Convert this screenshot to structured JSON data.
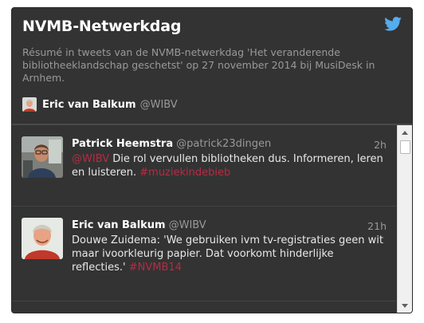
{
  "widget": {
    "title": "NVMB-Netwerkdag",
    "description": "Résumé in tweets van de NVMB-netwerkdag 'Het veranderende bibliotheeklandschap geschetst' op 27 november 2014 bij MusiDesk in Arnhem.",
    "curator": {
      "name": "Eric van Balkum",
      "handle": "@WIBV"
    },
    "icons": {
      "brand": "twitter-bird-icon"
    },
    "colors": {
      "background": "#333333",
      "link": "#b52c45",
      "brand": "#55acee"
    }
  },
  "tweets": [
    {
      "name": "Patrick Heemstra",
      "handle": "@patrick23dingen",
      "time": "2h",
      "mention": "@WIBV",
      "text": " Die rol vervullen bibliotheken dus. Informeren, leren en luisteren. ",
      "hashtag": "#muziekindebieb"
    },
    {
      "name": "Eric van Balkum",
      "handle": "@WIBV",
      "time": "21h",
      "text": "Douwe Zuidema: 'We gebruiken ivm tv-registraties geen wit maar ivoorkleurig papier. Dat voorkomt hinderlijke reflecties.' ",
      "hashtag": "#NVMB14"
    }
  ]
}
